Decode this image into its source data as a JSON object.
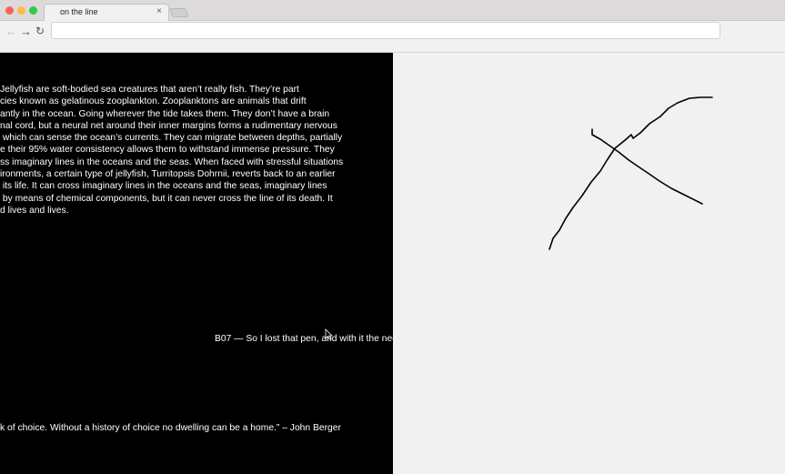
{
  "browser": {
    "tab_title": "on the line",
    "tab_close": "×",
    "url": "",
    "back": "←",
    "forward": "→",
    "reload": "↻"
  },
  "left_panel": {
    "paragraph_lines": [
      "Jellyfish are soft-bodied sea creatures that aren’t really fish. They’re part",
      "cies known as gelatinous zooplankton. Zooplanktons are animals that drift",
      "antly in the ocean. Going wherever the tide takes them. They don’t have a brain",
      "nal cord, but a neural net around their inner margins forms a rudimentary nervous",
      " which can sense the ocean’s currents. They can migrate between depths, partially",
      "e their 95% water consistency allows them to withstand immense pressure. They",
      "ss imaginary lines in the oceans and the seas. When faced with stressful situations",
      "ironments, a certain type of jellyfish, Turritopsis Dohrnii, reverts back to an earlier",
      " its life. It can cross imaginary lines in the oceans and the seas, imaginary lines",
      " by means of chemical components, but it can never cross the line of its death. It",
      "d lives and lives."
    ],
    "b07_line": "B07 — So I lost that pen, and with it the nee",
    "quote_line": "k of choice. Without a history of choice no dwelling can be a home.” – John Berger"
  },
  "colors": {
    "left_bg": "#000000",
    "right_bg": "#f1f1f1",
    "ink": "#000000"
  }
}
